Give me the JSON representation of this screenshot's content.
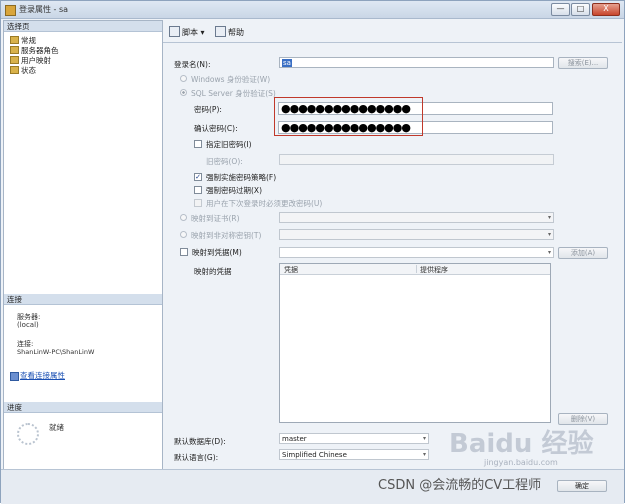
{
  "window": {
    "title": "登录属性 - sa",
    "minimize": "—",
    "maximize": "□",
    "close": "X"
  },
  "left": {
    "select_page_header": "选择页",
    "nav": [
      "常规",
      "服务器角色",
      "用户映射",
      "状态"
    ],
    "connection_header": "连接",
    "server_label": "服务器:",
    "server_value": "(local)",
    "connect_label": "连接:",
    "connect_value": "ShanLinW-PC\\ShanLinW",
    "view_props_link": "查看连接属性",
    "progress_header": "进度",
    "progress_status": "就绪"
  },
  "toolbar": {
    "script": "脚本",
    "help": "帮助"
  },
  "form": {
    "login_name_label": "登录名(N):",
    "login_name_value": "sa",
    "search_button": "搜索(E)...",
    "windows_auth": "Windows 身份验证(W)",
    "sql_auth": "SQL Server 身份验证(S)",
    "password_label": "密码(P):",
    "password_value": "●●●●●●●●●●●●●●●",
    "confirm_label": "确认密码(C):",
    "confirm_value": "●●●●●●●●●●●●●●●",
    "specify_old": "指定旧密码(I)",
    "old_password_label": "旧密码(O):",
    "enforce_policy": "强制实施密码策略(F)",
    "enforce_expiration": "强制密码过期(X)",
    "must_change": "用户在下次登录时必须更改密码(U)",
    "map_cert": "映射到证书(R)",
    "map_asym": "映射到非对称密钥(T)",
    "map_cred": "映射到凭据(M)",
    "add_button": "添加(A)",
    "mapped_creds_label": "映射的凭据",
    "grid_col_credential": "凭据",
    "grid_col_provider": "提供程序",
    "delete_button": "删除(V)",
    "default_db_label": "默认数据库(D):",
    "default_db_value": "master",
    "default_lang_label": "默认语言(G):",
    "default_lang_value": "Simplified Chinese"
  },
  "footer": {
    "ok_fragment": "确定"
  },
  "watermarks": {
    "baidu": "Baidu 经验",
    "jingyan": "jingyan.baidu.com",
    "csdn": "CSDN @会流畅的CV工程师"
  }
}
